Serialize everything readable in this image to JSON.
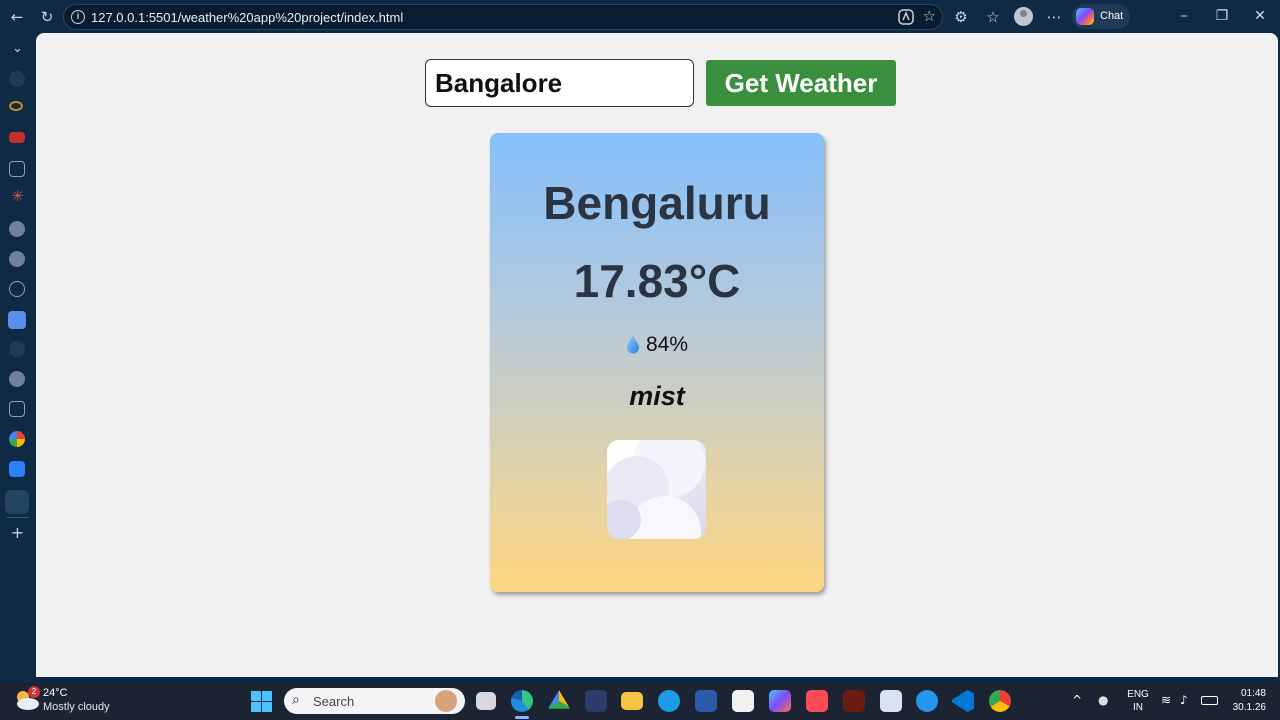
{
  "browser": {
    "url": "127.0.0.1:5501/weather%20app%20project/index.html",
    "chat_label": "Chat"
  },
  "app": {
    "city_input_value": "Bangalore",
    "get_weather_label": "Get Weather",
    "card": {
      "city": "Bengaluru",
      "temperature": "17.83°C",
      "humidity": "84%",
      "description": "mist",
      "gradient_top": "#86c0fb",
      "gradient_bottom": "#fdd580"
    }
  },
  "taskbar": {
    "weather_temp": "24°C",
    "weather_condition": "Mostly cloudy",
    "weather_badge": "2",
    "search_label": "Search",
    "lang_top": "ENG",
    "lang_bottom": "IN",
    "time": "01:48",
    "date": "30.1.26"
  }
}
